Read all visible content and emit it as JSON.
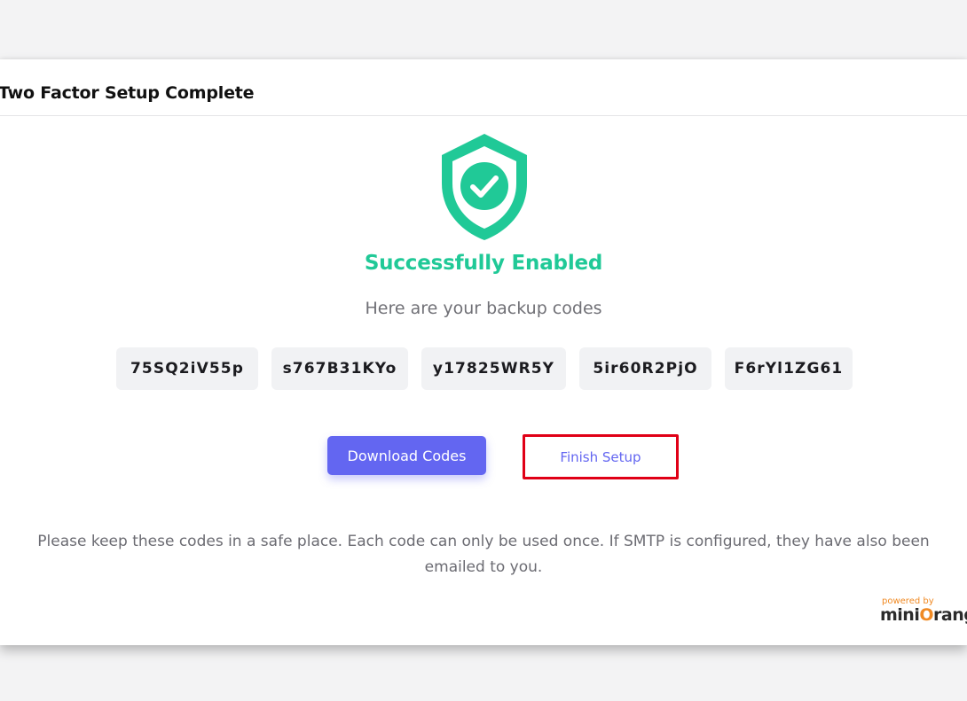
{
  "modal": {
    "title": "Two Factor Setup Complete"
  },
  "status": {
    "icon": "shield-check-icon",
    "heading": "Successfully Enabled",
    "subtitle": "Here are your backup codes"
  },
  "backup_codes": [
    "75SQ2iV55p",
    "s767B31KYo",
    "y17825WR5Y",
    "5ir60R2PjO",
    "F6rYl1ZG61"
  ],
  "actions": {
    "download_label": "Download Codes",
    "finish_label": "Finish Setup"
  },
  "note": "Please keep these codes in a safe place. Each code can only be used once. If SMTP is configured, they have also been emailed to you.",
  "branding": {
    "powered_by": "powered by",
    "brand_prefix": "mini",
    "brand_suffix": "rang"
  },
  "colors": {
    "success": "#20c997",
    "primary": "#6366f1",
    "highlight": "#e00016",
    "brand_accent": "#f08a24"
  }
}
